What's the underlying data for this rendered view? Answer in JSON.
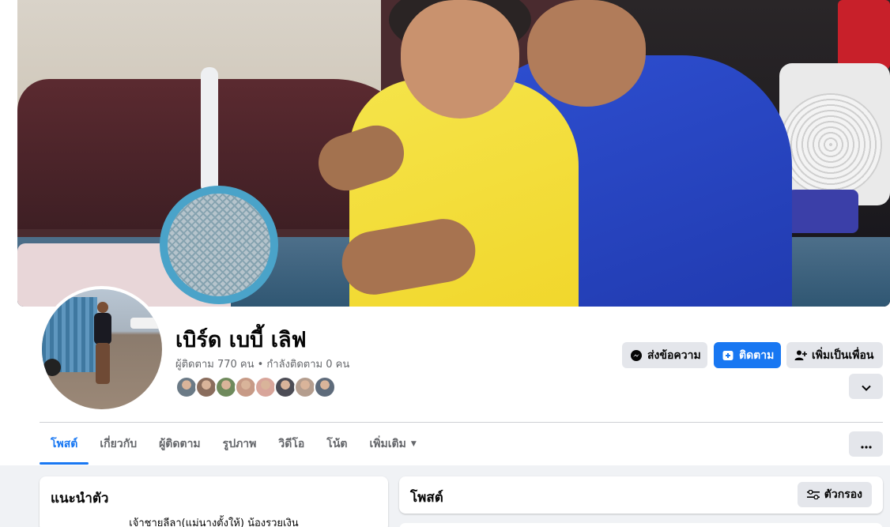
{
  "profile": {
    "name": "เบิร์ด เบบี้ เลิฟ",
    "stats": "ผู้ติดตาม 770 คน • กำลังติดตาม 0 คน",
    "friend_avatar_colors": [
      "#6b7a86",
      "#8a6d5d",
      "#6f8a5c",
      "#c79a86",
      "#d8a59a",
      "#4c4c55",
      "#b49d8e",
      "#5e6b7b"
    ]
  },
  "actions": {
    "message_label": "ส่งข้อความ",
    "follow_label": "ติดตาม",
    "add_friend_label": "เพิ่มเป็นเพื่อน"
  },
  "tabs": [
    {
      "label": "โพสต์",
      "active": true
    },
    {
      "label": "เกี่ยวกับ"
    },
    {
      "label": "ผู้ติดตาม"
    },
    {
      "label": "รูปภาพ"
    },
    {
      "label": "วิดีโอ"
    },
    {
      "label": "โน้ต"
    },
    {
      "label": "เพิ่มเติม"
    }
  ],
  "intro": {
    "title": "แนะนำตัว",
    "bio": "เจ้าชายลีลา(แม่นางตั้งให้) น้องรวยเงิน"
  },
  "posts": {
    "title": "โพสต์",
    "filter_label": "ตัวกรอง"
  },
  "colors": {
    "accent": "#1877f2",
    "button_gray": "#e4e6eb",
    "secondary_text": "#65676b"
  }
}
